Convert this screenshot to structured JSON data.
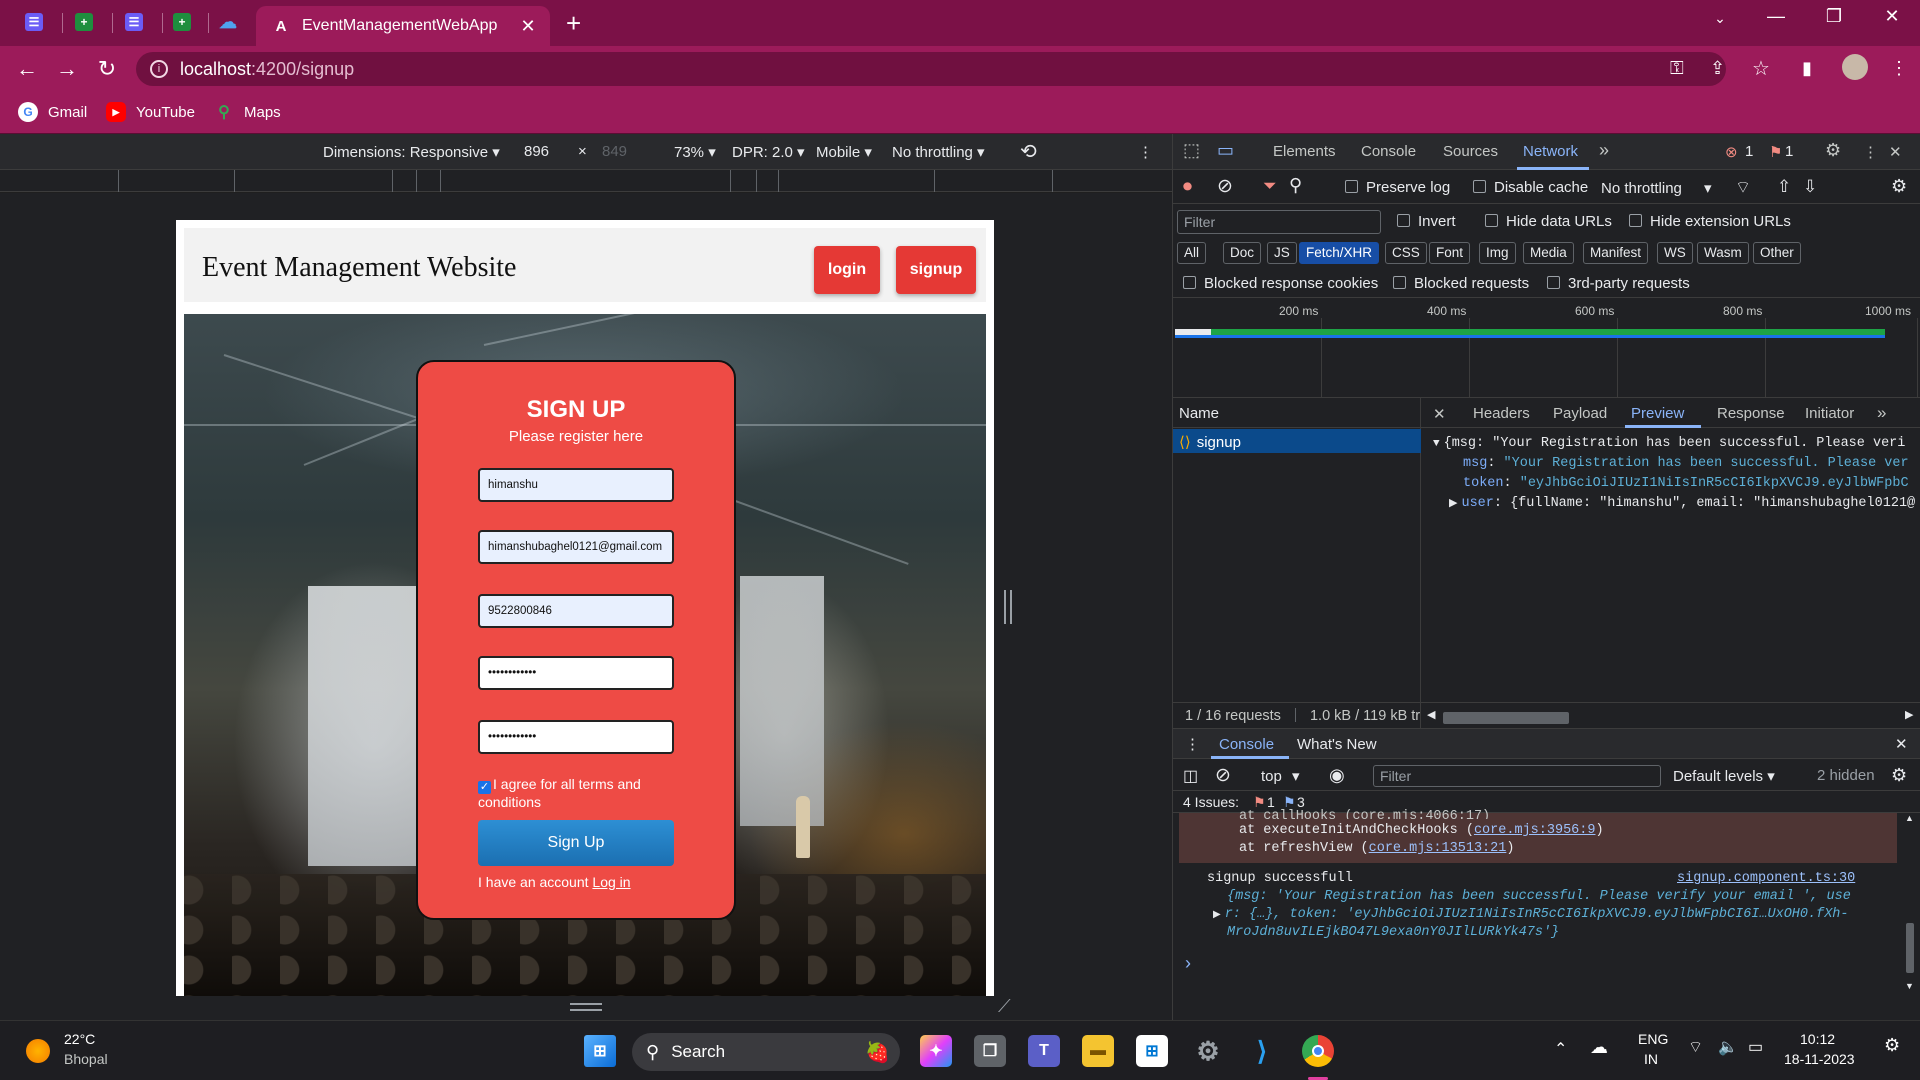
{
  "browser": {
    "pinned_tabs": [
      {
        "icon": "docs-list-icon",
        "color": "#6b5cf6"
      },
      {
        "icon": "sheets-icon",
        "color": "#1e8e3e"
      },
      {
        "icon": "docs-list-icon",
        "color": "#6b5cf6"
      },
      {
        "icon": "sheets-icon",
        "color": "#1e8e3e"
      },
      {
        "icon": "onedrive-icon",
        "color": "#1976d2"
      }
    ],
    "active_tab_title": "EventManagementWebApp",
    "new_tab_glyph": "+",
    "url_host": "localhost",
    "url_path": ":4200/signup",
    "bookmarks": [
      {
        "label": "Gmail",
        "icon": "google-icon"
      },
      {
        "label": "YouTube",
        "icon": "youtube-icon"
      },
      {
        "label": "Maps",
        "icon": "maps-icon"
      }
    ],
    "theme_color": "#9c1b5a"
  },
  "device_toolbar": {
    "dimensions": "Dimensions: Responsive ▾",
    "width": "896",
    "times": "×",
    "height": "849",
    "zoom": "73% ▾",
    "dpr": "DPR: 2.0 ▾",
    "device_type": "Mobile ▾",
    "throttling": "No throttling ▾"
  },
  "site": {
    "title": "Event Management Website",
    "login_label": "login",
    "signup_label": "signup",
    "accent": "#e53935",
    "card": {
      "heading": "SIGN UP",
      "subheading": "Please register here",
      "fields": {
        "name": "himanshu",
        "email": "himanshubaghel0121@gmail.com",
        "phone": "9522800846",
        "password": "••••••••••••",
        "confirm_password": "••••••••••••"
      },
      "terms_label": "I agree for all terms and conditions",
      "terms_checked": true,
      "submit_label": "Sign Up",
      "account_text": "I have an account ",
      "login_link": "Log in"
    }
  },
  "devtools": {
    "tabs": [
      "Elements",
      "Console",
      "Sources",
      "Network"
    ],
    "active_tab": "Network",
    "more_glyph": "»",
    "error_count": "1",
    "issue_count": "1",
    "preserve_log": "Preserve log",
    "disable_cache": "Disable cache",
    "throttling": "No throttling",
    "filter_placeholder": "Filter",
    "invert": "Invert",
    "hide_data_urls": "Hide data URLs",
    "hide_extension_urls": "Hide extension URLs",
    "type_filters": [
      "All",
      "Doc",
      "JS",
      "Fetch/XHR",
      "CSS",
      "Font",
      "Img",
      "Media",
      "Manifest",
      "WS",
      "Wasm",
      "Other"
    ],
    "active_type_filter": "Fetch/XHR",
    "blocked_cookies": "Blocked response cookies",
    "blocked_requests": "Blocked requests",
    "third_party": "3rd-party requests",
    "timeline_labels": [
      "200 ms",
      "400 ms",
      "600 ms",
      "800 ms",
      "1000 ms"
    ],
    "name_header": "Name",
    "request_name": "signup",
    "request_summary": "1 / 16 requests",
    "transfer_summary": "1.0 kB / 119 kB tr",
    "detail_tabs": [
      "Headers",
      "Payload",
      "Preview",
      "Response",
      "Initiator"
    ],
    "active_detail_tab": "Preview",
    "preview_lines": {
      "root": "{msg: \"Your Registration has been successful. Please veri",
      "msg_key": "msg",
      "msg_val": "\"Your Registration has been successful. Please ver",
      "token_key": "token",
      "token_val": "\"eyJhbGciOiJIUzI1NiIsInR5cCI6IkpXVCJ9.eyJlbWFpbC",
      "user_key": "user",
      "user_val": "{fullName: \"himanshu\", email: \"himanshubaghel0121@"
    },
    "drawer": {
      "tabs": [
        "Console",
        "What's New"
      ],
      "active_tab": "Console",
      "context": "top",
      "filter_placeholder": "Filter",
      "levels": "Default levels ▾",
      "hidden": "2 hidden",
      "issues_label": "4 Issues:",
      "issues_errors": "1",
      "issues_info": "3",
      "stack": [
        "at callHooks (core.mjs:4066:17)",
        "at executeInitAndCheckHooks (",
        "at refreshView ("
      ],
      "stack_links": [
        "core.mjs:3956:9",
        "core.mjs:13513:21"
      ],
      "log_message": "signup successfull",
      "log_source": "signup.component.ts:30",
      "log_obj_1": "{msg: 'Your Registration has been successful. Please verify your email ', use",
      "log_obj_2": "r: {…}, token: 'eyJhbGciOiJIUzI1NiIsInR5cCI6IkpXVCJ9.eyJlbWFpbCI6I…UxOH0.fXh-",
      "log_obj_3": "MroJdn8uvILEjkBO47L9exa0nY0JIlLURkYk47s'}",
      "prompt_glyph": "›"
    }
  },
  "taskbar": {
    "weather_temp": "22°C",
    "weather_city": "Bhopal",
    "search_label": "Search",
    "lang_1": "ENG",
    "lang_2": "IN",
    "time": "10:12",
    "date": "18-11-2023"
  }
}
